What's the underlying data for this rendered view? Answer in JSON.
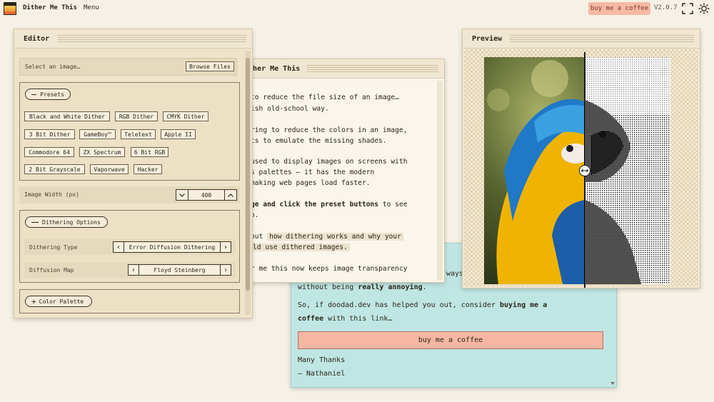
{
  "app": {
    "title": "Dither Me This",
    "menu_label": "Menu",
    "donate_label": "buy me a coffee",
    "version": "V2.0.7",
    "icons": [
      "app-logo-icon",
      "fullscreen-icon",
      "sun-icon"
    ]
  },
  "editor": {
    "title": "Editor",
    "select_image_label": "Select an image…",
    "browse_label": "Browse Files",
    "presets_label": "Presets",
    "presets": [
      "Black and White Dither",
      "RGB Dither",
      "CMYK Dither",
      "3 Bit Dither",
      "GameBoy™",
      "Teletext",
      "Apple II",
      "Commodore 64",
      "ZX Spectrum",
      "6 Bit RGB",
      "2 Bit Grayscale",
      "Vaporwave",
      "Hacker"
    ],
    "width_label": "Image Width (px)",
    "width_value": "400",
    "dithering_options_label": "Dithering Options",
    "dithering_type_label": "Dithering Type",
    "dithering_type_value": "Error Diffusion Dithering",
    "diffusion_map_label": "Diffusion Map",
    "diffusion_map_value": "Floyd Steinberg",
    "color_palette_label": "Color Palette"
  },
  "info": {
    "title": "ither Me This",
    "lines": [
      "to reduce the file size of an image…",
      "ish old-school way.",
      "ring to reduce the colors in an image,",
      "ts to emulate the missing shades.",
      "used to display images on screens with",
      "s palettes — it has the modern",
      "making web pages load faster.",
      "ge and click the",
      "preset buttons",
      "to see",
      "o.",
      "out",
      "how dithering works and why your",
      "ld use dithered images.",
      "r me this now keeps image transparency"
    ]
  },
  "donate_window": {
    "line1_tail": "ways",
    "line2_a": "without being",
    "line2_b": "really annoying",
    "line2_c": ".",
    "line3_a": "So, if doodad.dev has helped you out, consider",
    "line3_b": "buying me a",
    "line4_a": "coffee",
    "line4_b": "with this link…",
    "button_label": "buy me a coffee",
    "thanks": "Many Thanks",
    "signature": "— Nathaniel"
  },
  "preview": {
    "title": "Preview",
    "compare_position": 0.5
  },
  "colors": {
    "background": "#f6f1e6",
    "donate_accent": "#f5b9a6",
    "donate_panel": "#bfe6e3",
    "logo_stripes": [
      "#2b2418",
      "#f2c14e",
      "#e56b2c",
      "#c62a39"
    ]
  }
}
